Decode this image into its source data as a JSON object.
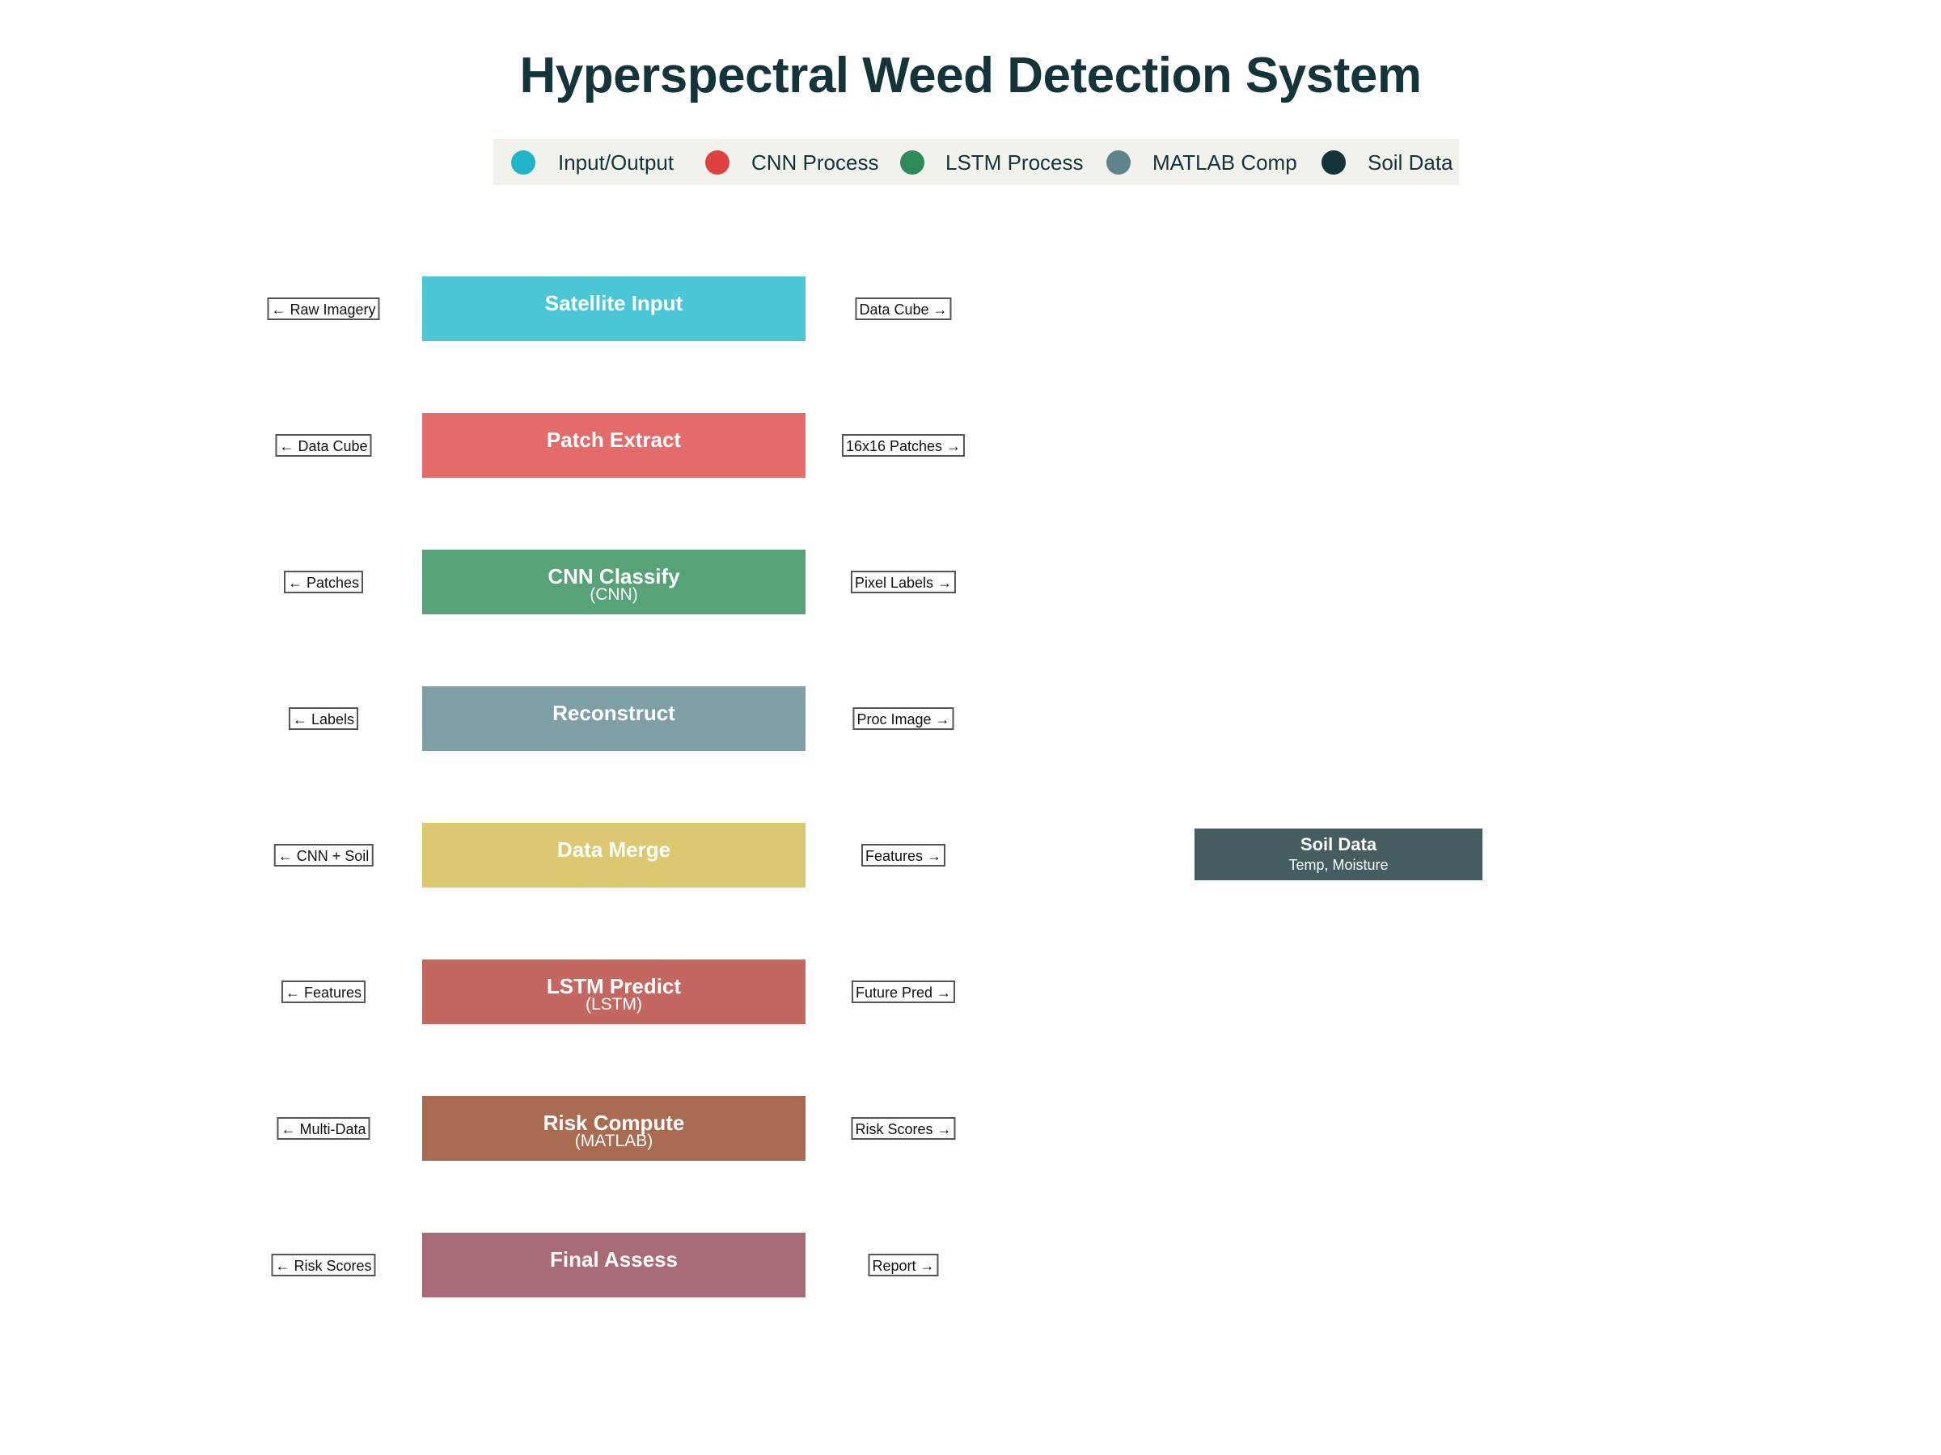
{
  "title": "Hyperspectral Weed Detection System",
  "legend": [
    {
      "label": "Input/Output",
      "color": "#22b5c8"
    },
    {
      "label": "CNN Process",
      "color": "#de4240"
    },
    {
      "label": "LSTM Process",
      "color": "#2e8b57"
    },
    {
      "label": "MATLAB Comp",
      "color": "#5e838c"
    },
    {
      "label": "Soil Data",
      "color": "#13343b"
    }
  ],
  "steps": [
    {
      "name": "Satellite Input",
      "sub": "",
      "color": "#4bc6d6",
      "input": "← Raw Imagery",
      "output": "Data Cube →"
    },
    {
      "name": "Patch Extract",
      "sub": "",
      "color": "#e36b6a",
      "input": "← Data Cube",
      "output": "16x16 Patches →"
    },
    {
      "name": "CNN Classify",
      "sub": "(CNN)",
      "color": "#57a276",
      "input": "← Patches",
      "output": "Pixel Labels →"
    },
    {
      "name": "Reconstruct",
      "sub": "",
      "color": "#7f9fa6",
      "input": "← Labels",
      "output": "Proc Image →"
    },
    {
      "name": "Data Merge",
      "sub": "",
      "color": "#dcc870",
      "input": "← CNN + Soil",
      "output": "Features →"
    },
    {
      "name": "LSTM Predict",
      "sub": "(LSTM)",
      "color": "#c36760",
      "input": "← Features",
      "output": "Future Pred →"
    },
    {
      "name": "Risk Compute",
      "sub": "(MATLAB)",
      "color": "#a86a50",
      "input": "← Multi-Data",
      "output": "Risk Scores →"
    },
    {
      "name": "Final Assess",
      "sub": "",
      "color": "#a86a75",
      "input": "← Risk Scores",
      "output": "Report →"
    }
  ],
  "soil": {
    "name": "Soil Data",
    "sub": "Temp, Moisture",
    "color": "#445d61"
  }
}
